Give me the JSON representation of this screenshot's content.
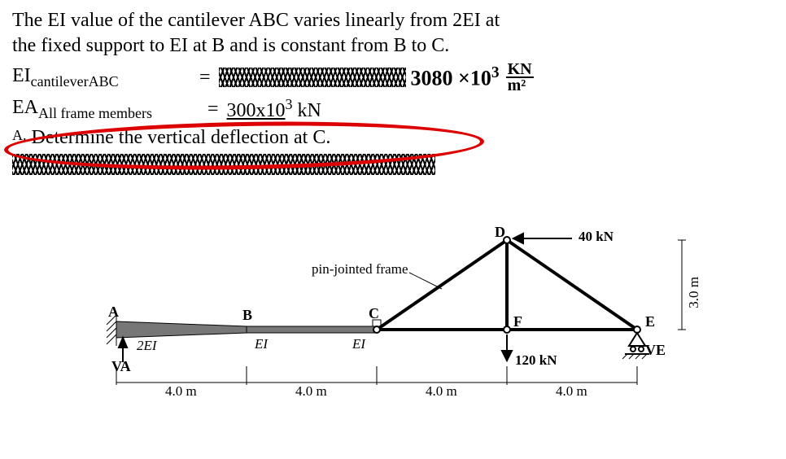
{
  "problem": {
    "line1": "The EI value of the cantilever ABC varies linearly from 2EI at",
    "line2": "the fixed support to EI at B and is constant from B to C.",
    "ei_label_html": "EI",
    "ei_sub": "cantileverABC",
    "ei_equals": "=",
    "ei_value_hand": "3080 ×10",
    "ei_value_exp": "3",
    "ei_unit_top": "KN",
    "ei_unit_bot": "m²",
    "ea_label_html": "EA",
    "ea_sub": "All frame members",
    "ea_equals": "=",
    "ea_value": "300x10",
    "ea_value_exp": "3",
    "ea_unit": " kN",
    "task_prefix": "A.",
    "task": "Determine the vertical deflection at C."
  },
  "diagram": {
    "label_A": "A",
    "label_B": "B",
    "label_C": "C",
    "label_D": "D",
    "label_E": "E",
    "label_F": "F",
    "ei_2": "2EI",
    "ei_1_left": "EI",
    "ei_1_right": "EI",
    "hand_VA": "VA",
    "hand_VE": "VE",
    "frame_label": "pin-jointed frame",
    "load_D": "40 kN",
    "load_F": "120 kN",
    "spans": [
      "4.0 m",
      "4.0 m",
      "4.0 m",
      "4.0 m"
    ],
    "height": "3.0 m"
  },
  "chart_data": {
    "type": "diagram",
    "description": "Cantilever ABC with a pin-jointed truss CDFE attached at C and supported on a roller at E.",
    "spans_m": [
      4.0,
      4.0,
      4.0,
      4.0
    ],
    "truss_height_m": 3.0,
    "EI_cantilever_kN_per_m2": 3080000,
    "EI_variation": "linear 2EI at A to EI at B, constant EI from B to C",
    "EA_frame_kN": 300000,
    "loads": [
      {
        "node": "D",
        "type": "horizontal",
        "magnitude_kN": 40,
        "direction": "left"
      },
      {
        "node": "F",
        "type": "vertical",
        "magnitude_kN": 120,
        "direction": "down"
      }
    ],
    "supports": [
      {
        "node": "A",
        "type": "fixed"
      },
      {
        "node": "E",
        "type": "roller"
      }
    ],
    "nodes": [
      "A",
      "B",
      "C",
      "D",
      "E",
      "F"
    ],
    "unknown": "vertical deflection at C"
  }
}
